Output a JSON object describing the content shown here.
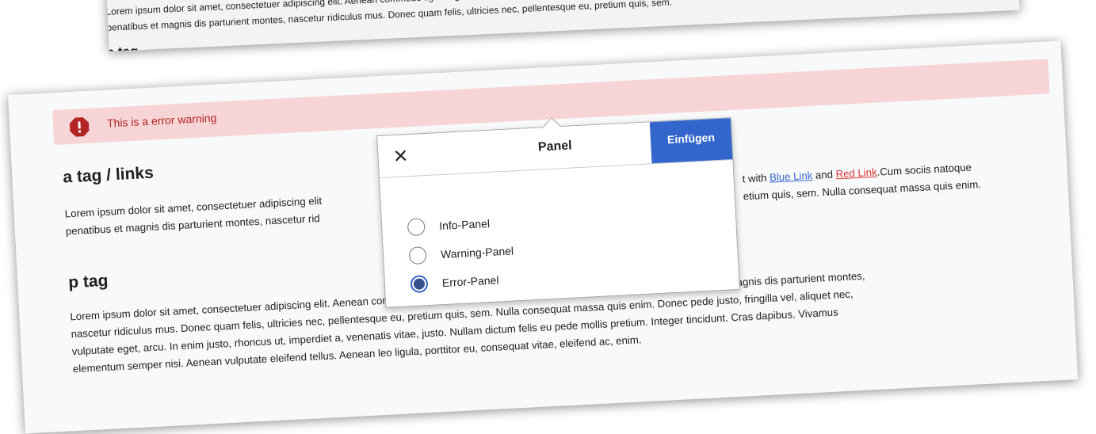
{
  "background_sheet": {
    "line1": "Lorem ipsum dolor sit amet, consectetuer adipiscing elit. Aenean commodo ligula eget dolor. Aenean massa. Some text with Blue Link and Red Link.",
    "line2": "penatibus et magnis dis parturient montes, nascetur ridiculus mus. Donec quam felis, ultricies nec, pellentesque eu, pretium quis, sem.",
    "heading": "p tag"
  },
  "message": {
    "text": "This is a error warning",
    "icon": "error-icon",
    "bg_color": "#f7d5d7",
    "text_color": "#b32424"
  },
  "section_links": {
    "heading": "a tag / links",
    "para_line1_left": "Lorem ipsum dolor sit amet, consectetuer adipiscing elit",
    "para_line1_mid": "t with ",
    "blue_link": "Blue Link",
    "and_word": " and ",
    "red_link": "Red Link",
    "para_line1_end": ".Cum sociis natoque",
    "para_line2_left": "penatibus et magnis dis parturient montes, nascetur rid",
    "para_line2_right": "etium quis, sem. Nulla consequat massa quis enim."
  },
  "section_p": {
    "heading": "p tag",
    "lines": [
      "Lorem ipsum dolor sit amet, consectetuer adipiscing elit. Aenean commodo ligula eget dolor. Aenean massa. Cum sociis natoque penatibus et magnis dis parturient montes,",
      "nascetur ridiculus mus. Donec quam felis, ultricies nec, pellentesque eu, pretium quis, sem. Nulla consequat massa quis enim. Donec pede justo, fringilla vel, aliquet nec,",
      "vulputate eget, arcu. In enim justo, rhoncus ut, imperdiet a, venenatis vitae, justo. Nullam dictum felis eu pede mollis pretium. Integer tincidunt. Cras dapibus. Vivamus",
      "elementum semper nisi. Aenean vulputate eleifend tellus. Aenean leo ligula, porttitor eu, consequat vitae, eleifend ac, enim."
    ]
  },
  "popup": {
    "title": "Panel",
    "close_icon": "close-icon",
    "insert_label": "Einfügen",
    "accent_color": "#3366cc",
    "options": [
      {
        "label": "Info-Panel",
        "checked": false
      },
      {
        "label": "Warning-Panel",
        "checked": false
      },
      {
        "label": "Error-Panel",
        "checked": true
      }
    ]
  }
}
